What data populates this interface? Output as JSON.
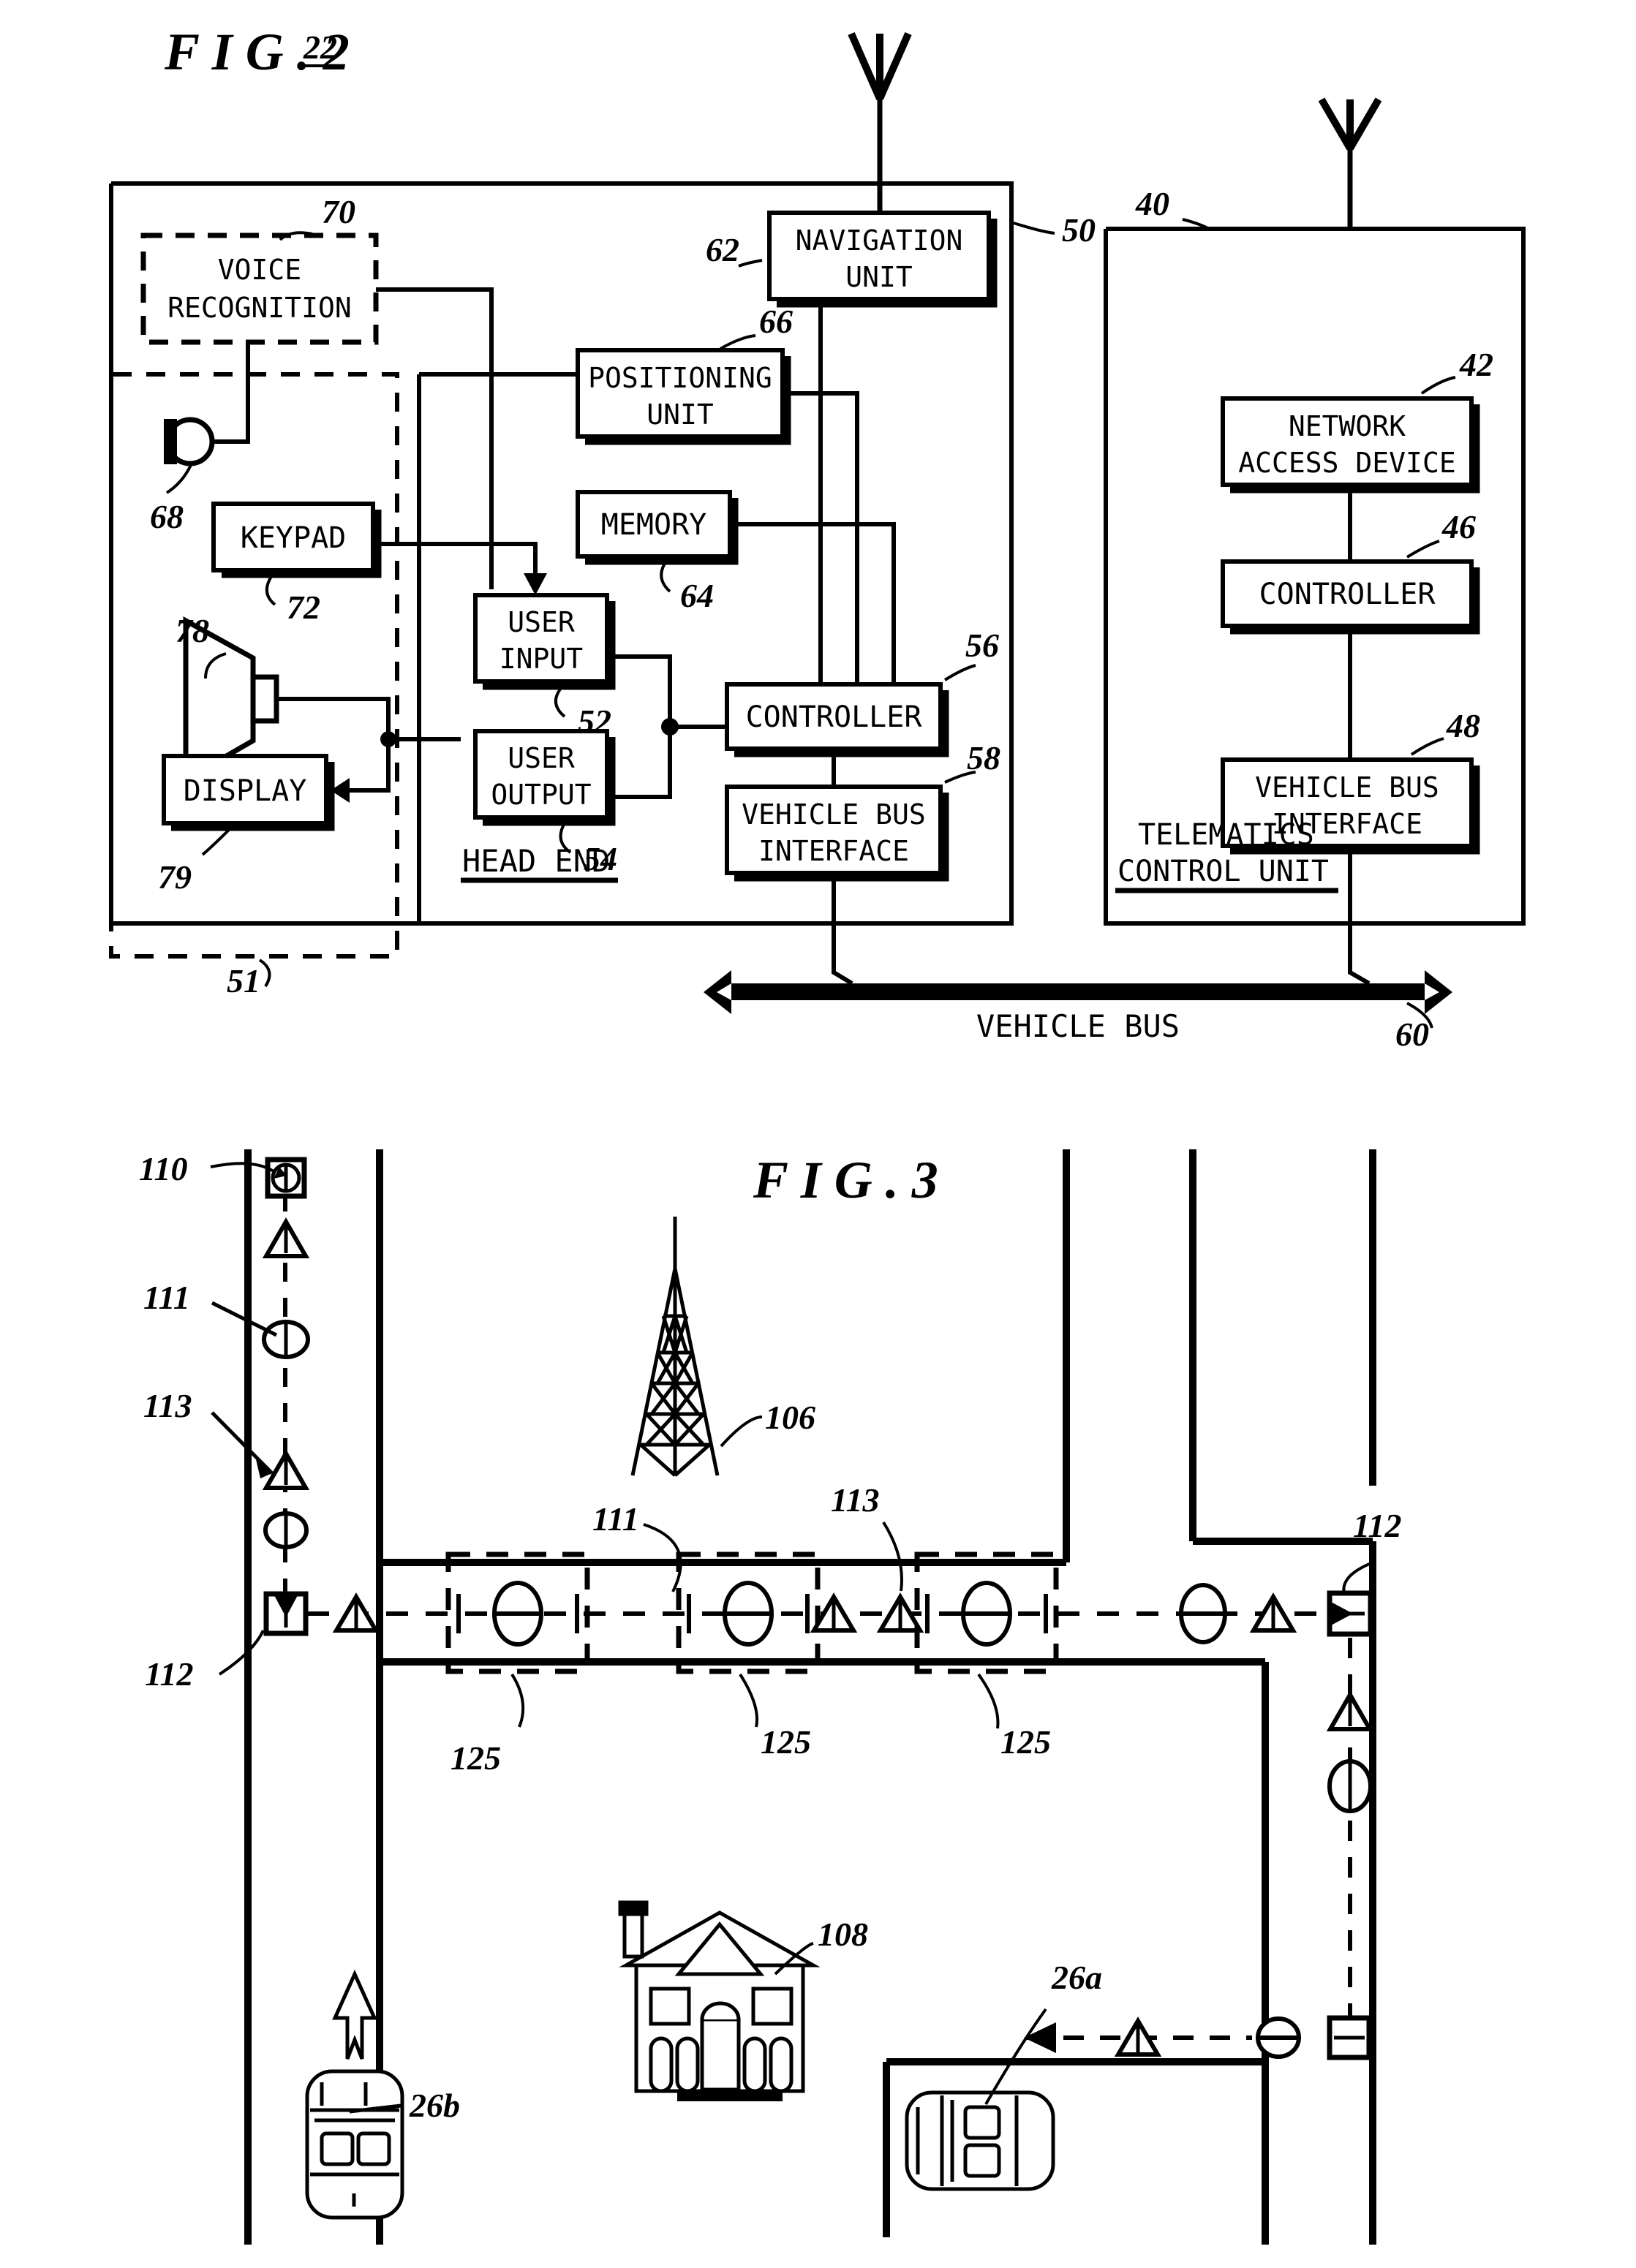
{
  "figure2": {
    "title": "F I G .   2",
    "system_ref": "22",
    "blocks": [
      {
        "id": "voice_recognition",
        "label_line1": "VOICE",
        "label_line2": "RECOGNITION",
        "ref": "70",
        "style": "dashed"
      },
      {
        "id": "navigation_unit",
        "label_line1": "NAVIGATION",
        "label_line2": "UNIT",
        "ref": "62",
        "style": "solid"
      },
      {
        "id": "positioning_unit",
        "label_line1": "POSITIONING",
        "label_line2": "UNIT",
        "ref": "66",
        "style": "solid"
      },
      {
        "id": "memory",
        "label_line1": "MEMORY",
        "label_line2": "",
        "ref": "64",
        "style": "solid"
      },
      {
        "id": "keypad",
        "label_line1": "KEYPAD",
        "label_line2": "",
        "ref": "72",
        "style": "solid"
      },
      {
        "id": "user_input",
        "label_line1": "USER",
        "label_line2": "INPUT",
        "ref": "52",
        "style": "solid"
      },
      {
        "id": "user_output",
        "label_line1": "USER",
        "label_line2": "OUTPUT",
        "ref": "54",
        "style": "solid"
      },
      {
        "id": "display",
        "label_line1": "DISPLAY",
        "label_line2": "",
        "ref": "79",
        "style": "solid"
      },
      {
        "id": "head_end_controller",
        "label_line1": "CONTROLLER",
        "label_line2": "",
        "ref": "56",
        "style": "solid"
      },
      {
        "id": "head_end_vbi",
        "label_line1": "VEHICLE BUS",
        "label_line2": "INTERFACE",
        "ref": "58",
        "style": "solid"
      },
      {
        "id": "network_access_device",
        "label_line1": "NETWORK",
        "label_line2": "ACCESS DEVICE",
        "ref": "42",
        "style": "solid"
      },
      {
        "id": "tcu_controller",
        "label_line1": "CONTROLLER",
        "label_line2": "",
        "ref": "46",
        "style": "solid"
      },
      {
        "id": "tcu_vbi",
        "label_line1": "VEHICLE BUS",
        "label_line2": "INTERFACE",
        "ref": "48",
        "style": "solid"
      }
    ],
    "group_labels": [
      {
        "id": "head_end",
        "text": "HEAD END",
        "ref": ""
      },
      {
        "id": "telematics_control_unit",
        "line1": "TELEMATICS",
        "line2": "CONTROL UNIT",
        "ref": "40"
      }
    ],
    "unlabeled_refs": [
      {
        "id": "microphone",
        "ref": "68"
      },
      {
        "id": "speaker",
        "ref": "78"
      },
      {
        "id": "user_interface_group",
        "ref": "51"
      },
      {
        "id": "head_end_group",
        "ref": "50"
      }
    ],
    "vehicle_bus": {
      "label": "VEHICLE BUS",
      "ref": "60"
    }
  },
  "figure3": {
    "title": "F I G .   3",
    "items": [
      {
        "id": "start_marker",
        "ref": "110",
        "icon": "square-start-icon"
      },
      {
        "id": "route_circle_marker",
        "ref": "111",
        "icon": "circle-waypoint-icon"
      },
      {
        "id": "route_triangle_marker",
        "ref": "113",
        "icon": "triangle-waypoint-icon"
      },
      {
        "id": "destination_marker",
        "ref": "112",
        "icon": "square-arrow-icon"
      },
      {
        "id": "cell_tower",
        "ref": "106",
        "icon": "cell-tower-icon"
      },
      {
        "id": "house",
        "ref": "108",
        "icon": "house-icon"
      },
      {
        "id": "vehicle_a",
        "ref": "26a",
        "icon": "car-top-view-icon"
      },
      {
        "id": "vehicle_b",
        "ref": "26b",
        "icon": "car-top-view-icon"
      }
    ],
    "zone_refs": [
      "125",
      "125",
      "125"
    ],
    "route_marker_refs_secondary": {
      "circle": "111",
      "triangle": "113",
      "end": "112"
    }
  },
  "colors": {
    "ink": "#000000",
    "paper": "#ffffff"
  }
}
